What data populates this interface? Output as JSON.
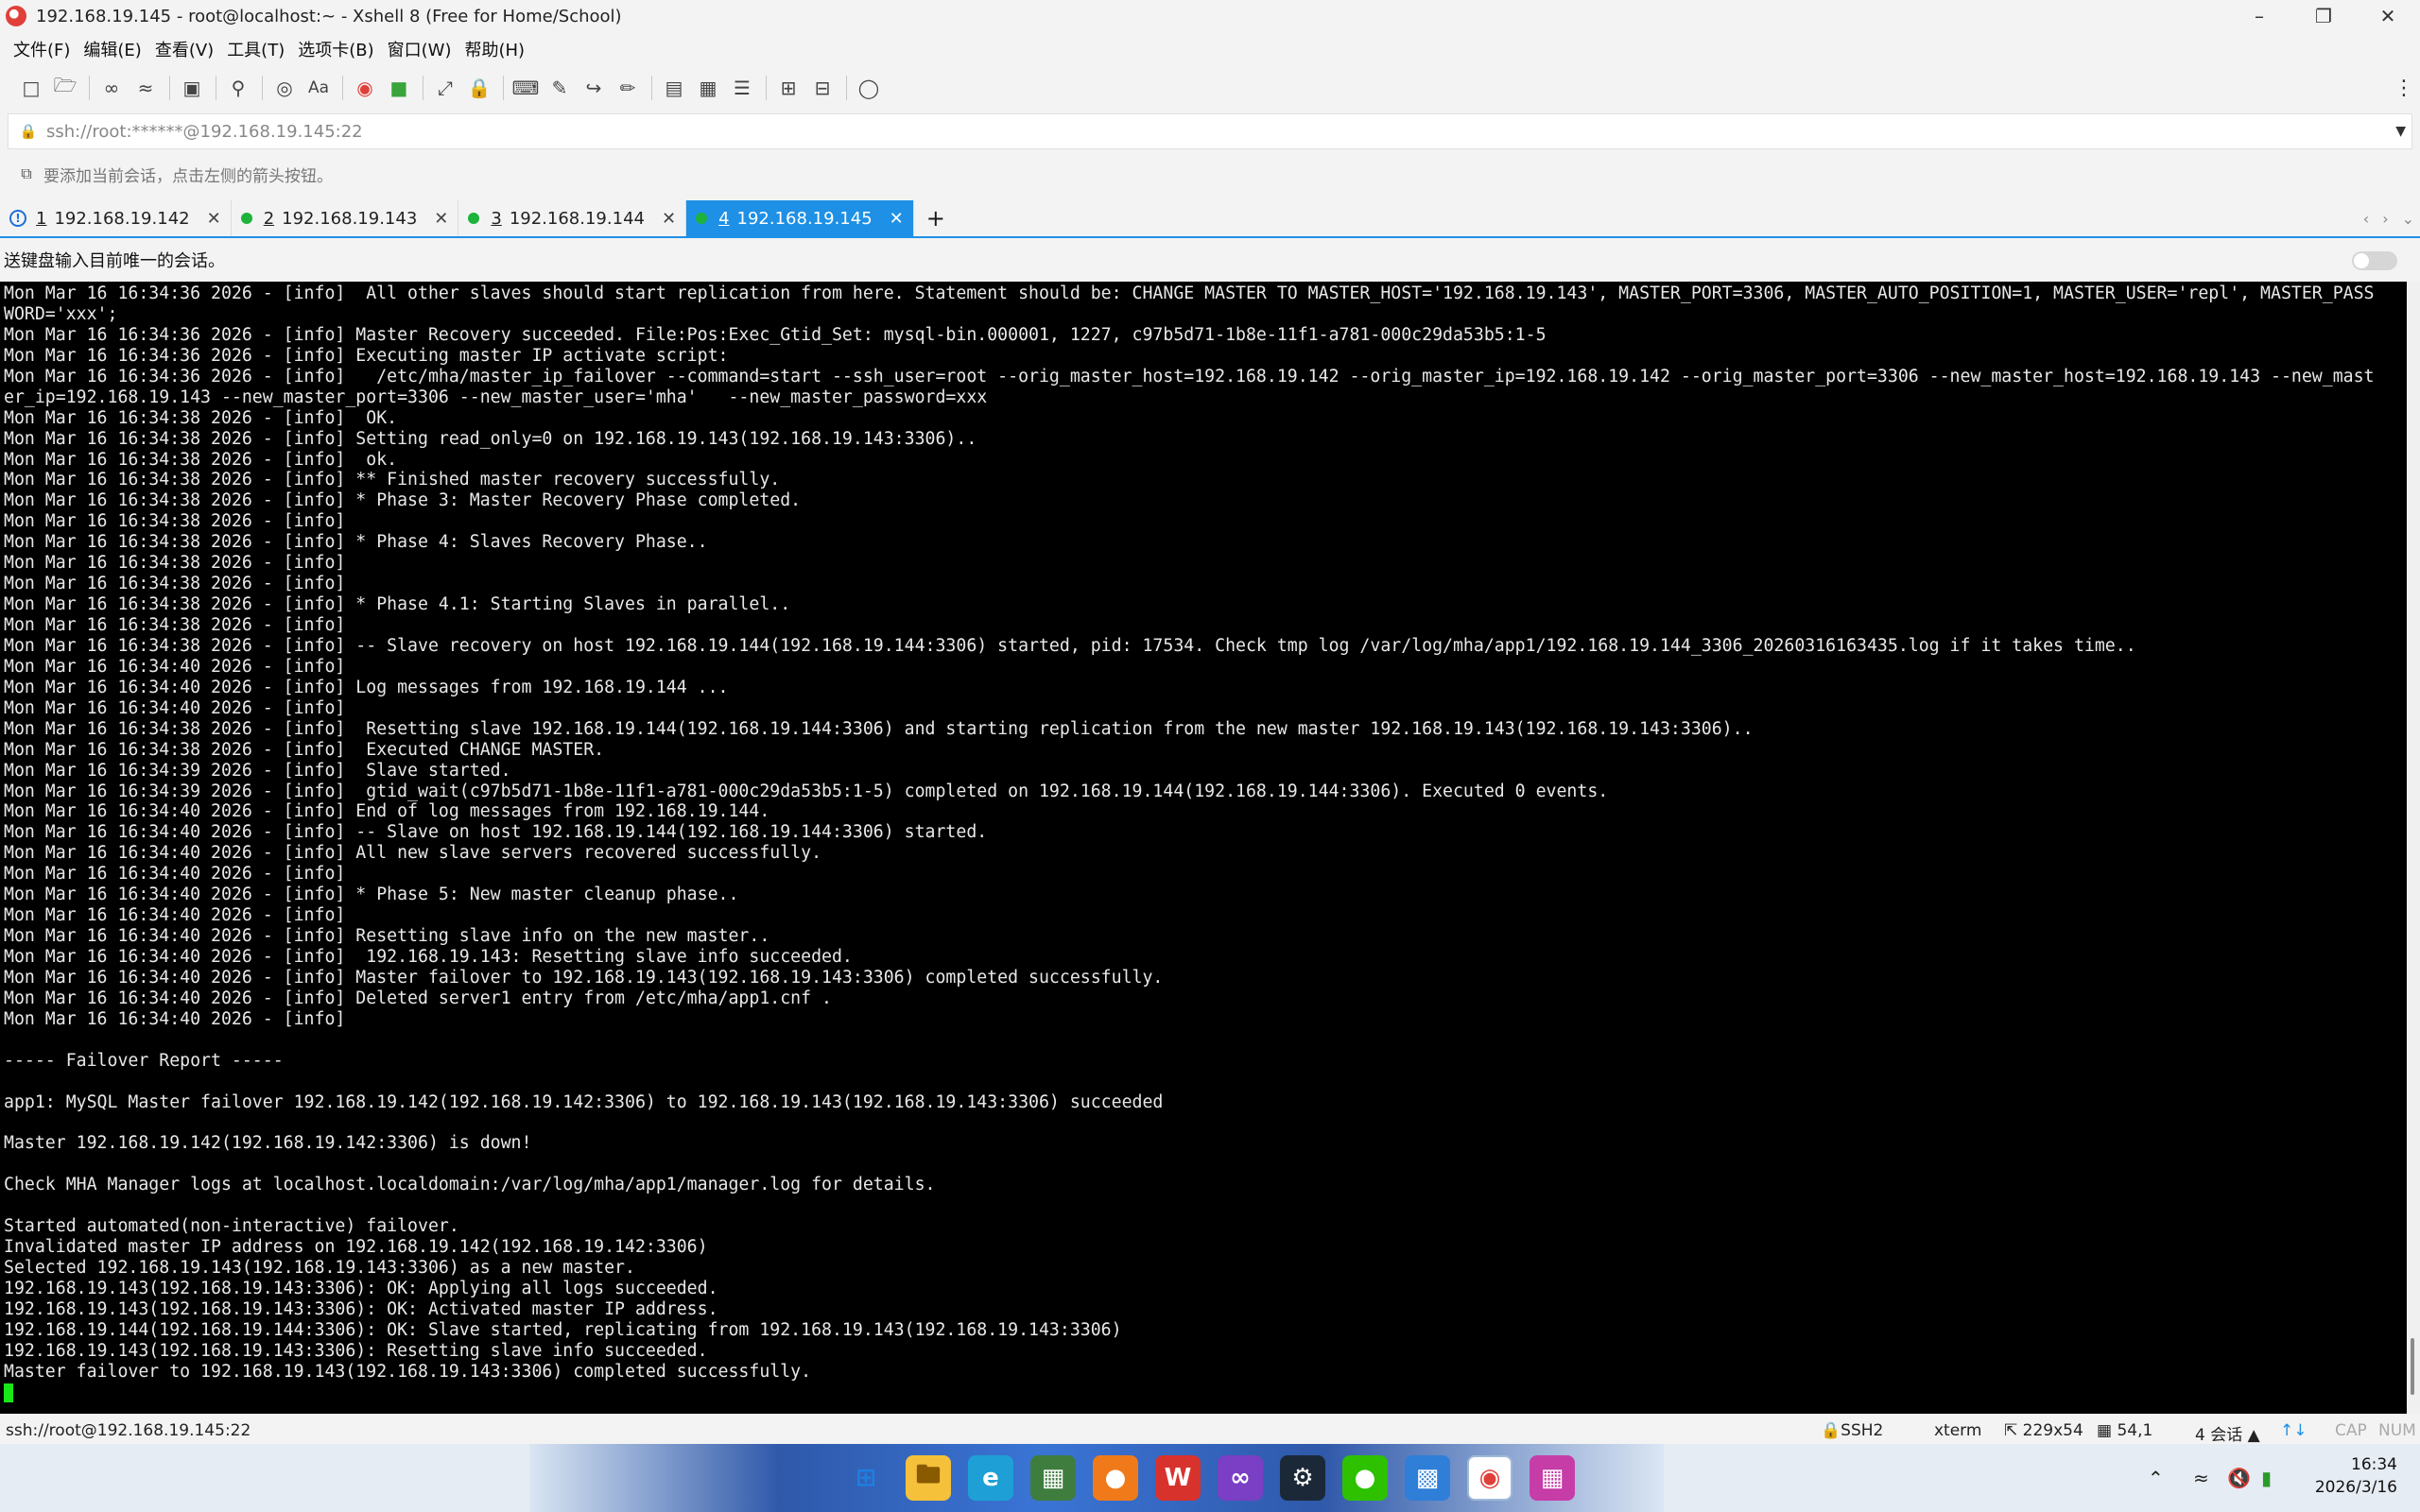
{
  "window": {
    "title": "192.168.19.145 - root@localhost:~ - Xshell 8 (Free for Home/School)",
    "controls": [
      "minimize",
      "maximize",
      "close"
    ]
  },
  "menu": [
    "文件(F)",
    "编辑(E)",
    "查看(V)",
    "工具(T)",
    "选项卡(B)",
    "窗口(W)",
    "帮助(H)"
  ],
  "toolbar": {
    "icons": [
      "new-session-icon",
      "open-icon",
      "connect-icon",
      "disconnect-icon",
      "new-window-icon",
      "find-icon",
      "globe-icon",
      "font-icon",
      "xftp-icon",
      "xmanager-icon",
      "fullscreen-icon",
      "lock-icon",
      "keyboard-icon",
      "script-icon",
      "transfer-icon",
      "log-icon",
      "compose-icon",
      "highlight-icon",
      "notes-icon",
      "add-tab-icon",
      "layout-icon",
      "chat-icon"
    ]
  },
  "address": {
    "value": "ssh://root:******@192.168.19.145:22"
  },
  "hint": {
    "text": "要添加当前会话，点击左侧的箭头按钮。"
  },
  "tabs": [
    {
      "num": "1",
      "label": "192.168.19.142",
      "status": "warning",
      "active": false
    },
    {
      "num": "2",
      "label": "192.168.19.143",
      "status": "connected",
      "active": false
    },
    {
      "num": "3",
      "label": "192.168.19.144",
      "status": "connected",
      "active": false
    },
    {
      "num": "4",
      "label": "192.168.19.145",
      "status": "connected",
      "active": true
    }
  ],
  "compose": {
    "text": "送键盘输入目前唯一的会话。"
  },
  "terminal": {
    "lines": [
      "Mon Mar 16 16:34:36 2026 - [info]  All other slaves should start replication from here. Statement should be: CHANGE MASTER TO MASTER_HOST='192.168.19.143', MASTER_PORT=3306, MASTER_AUTO_POSITION=1, MASTER_USER='repl', MASTER_PASS",
      "WORD='xxx';",
      "Mon Mar 16 16:34:36 2026 - [info] Master Recovery succeeded. File:Pos:Exec_Gtid_Set: mysql-bin.000001, 1227, c97b5d71-1b8e-11f1-a781-000c29da53b5:1-5",
      "Mon Mar 16 16:34:36 2026 - [info] Executing master IP activate script:",
      "Mon Mar 16 16:34:36 2026 - [info]   /etc/mha/master_ip_failover --command=start --ssh_user=root --orig_master_host=192.168.19.142 --orig_master_ip=192.168.19.142 --orig_master_port=3306 --new_master_host=192.168.19.143 --new_mast",
      "er_ip=192.168.19.143 --new_master_port=3306 --new_master_user='mha'   --new_master_password=xxx",
      "Mon Mar 16 16:34:38 2026 - [info]  OK.",
      "Mon Mar 16 16:34:38 2026 - [info] Setting read_only=0 on 192.168.19.143(192.168.19.143:3306)..",
      "Mon Mar 16 16:34:38 2026 - [info]  ok.",
      "Mon Mar 16 16:34:38 2026 - [info] ** Finished master recovery successfully.",
      "Mon Mar 16 16:34:38 2026 - [info] * Phase 3: Master Recovery Phase completed.",
      "Mon Mar 16 16:34:38 2026 - [info]",
      "Mon Mar 16 16:34:38 2026 - [info] * Phase 4: Slaves Recovery Phase..",
      "Mon Mar 16 16:34:38 2026 - [info]",
      "Mon Mar 16 16:34:38 2026 - [info]",
      "Mon Mar 16 16:34:38 2026 - [info] * Phase 4.1: Starting Slaves in parallel..",
      "Mon Mar 16 16:34:38 2026 - [info]",
      "Mon Mar 16 16:34:38 2026 - [info] -- Slave recovery on host 192.168.19.144(192.168.19.144:3306) started, pid: 17534. Check tmp log /var/log/mha/app1/192.168.19.144_3306_20260316163435.log if it takes time..",
      "Mon Mar 16 16:34:40 2026 - [info]",
      "Mon Mar 16 16:34:40 2026 - [info] Log messages from 192.168.19.144 ...",
      "Mon Mar 16 16:34:40 2026 - [info]",
      "Mon Mar 16 16:34:38 2026 - [info]  Resetting slave 192.168.19.144(192.168.19.144:3306) and starting replication from the new master 192.168.19.143(192.168.19.143:3306)..",
      "Mon Mar 16 16:34:38 2026 - [info]  Executed CHANGE MASTER.",
      "Mon Mar 16 16:34:39 2026 - [info]  Slave started.",
      "Mon Mar 16 16:34:39 2026 - [info]  gtid_wait(c97b5d71-1b8e-11f1-a781-000c29da53b5:1-5) completed on 192.168.19.144(192.168.19.144:3306). Executed 0 events.",
      "Mon Mar 16 16:34:40 2026 - [info] End of log messages from 192.168.19.144.",
      "Mon Mar 16 16:34:40 2026 - [info] -- Slave on host 192.168.19.144(192.168.19.144:3306) started.",
      "Mon Mar 16 16:34:40 2026 - [info] All new slave servers recovered successfully.",
      "Mon Mar 16 16:34:40 2026 - [info]",
      "Mon Mar 16 16:34:40 2026 - [info] * Phase 5: New master cleanup phase..",
      "Mon Mar 16 16:34:40 2026 - [info]",
      "Mon Mar 16 16:34:40 2026 - [info] Resetting slave info on the new master..",
      "Mon Mar 16 16:34:40 2026 - [info]  192.168.19.143: Resetting slave info succeeded.",
      "Mon Mar 16 16:34:40 2026 - [info] Master failover to 192.168.19.143(192.168.19.143:3306) completed successfully.",
      "Mon Mar 16 16:34:40 2026 - [info] Deleted server1 entry from /etc/mha/app1.cnf .",
      "Mon Mar 16 16:34:40 2026 - [info]",
      "",
      "----- Failover Report -----",
      "",
      "app1: MySQL Master failover 192.168.19.142(192.168.19.142:3306) to 192.168.19.143(192.168.19.143:3306) succeeded",
      "",
      "Master 192.168.19.142(192.168.19.142:3306) is down!",
      "",
      "Check MHA Manager logs at localhost.localdomain:/var/log/mha/app1/manager.log for details.",
      "",
      "Started automated(non-interactive) failover.",
      "Invalidated master IP address on 192.168.19.142(192.168.19.142:3306)",
      "Selected 192.168.19.143(192.168.19.143:3306) as a new master.",
      "192.168.19.143(192.168.19.143:3306): OK: Applying all logs succeeded.",
      "192.168.19.143(192.168.19.143:3306): OK: Activated master IP address.",
      "192.168.19.144(192.168.19.144:3306): OK: Slave started, replicating from 192.168.19.143(192.168.19.143:3306)",
      "192.168.19.143(192.168.19.143:3306): Resetting slave info succeeded.",
      "Master failover to 192.168.19.143(192.168.19.143:3306) completed successfully."
    ],
    "cursor_color": "#19e619"
  },
  "statusbar": {
    "connection": "ssh://root@192.168.19.145:22",
    "protocol": "SSH2",
    "term": "xterm",
    "size": "229x54",
    "position": "54,1",
    "sessions": "4 会话",
    "caps": "CAP",
    "num": "NUM"
  },
  "taskbar": {
    "apps": [
      "start-icon",
      "file-explorer-icon",
      "edge-icon",
      "calculator-icon",
      "browser-icon",
      "wps-icon",
      "visual-studio-icon",
      "steam-icon",
      "wechat-icon",
      "remote-desktop-icon",
      "xshell-icon",
      "xftp-icon"
    ],
    "time": "16:34",
    "date": "2026/3/16"
  },
  "colors": {
    "accent": "#1e90e6",
    "terminal_bg": "#000000",
    "terminal_fg": "#e8e8e8",
    "status_green": "#1db33c"
  }
}
